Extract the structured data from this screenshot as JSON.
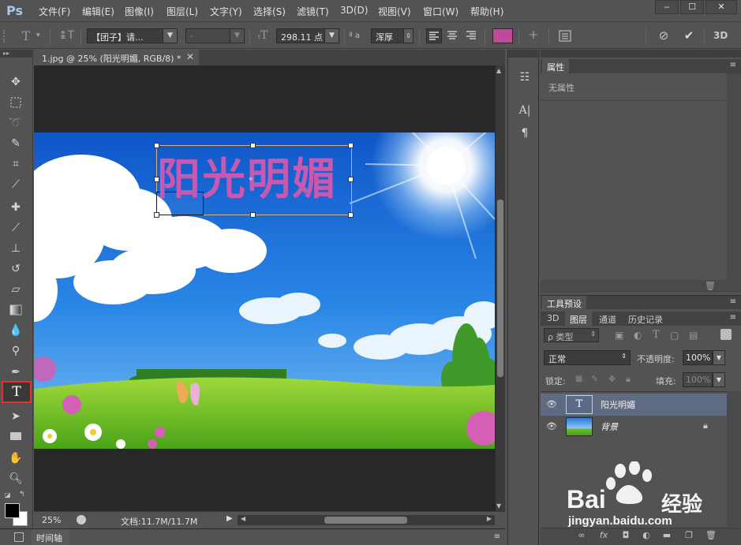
{
  "app": {
    "logo": "Ps",
    "menu": [
      "文件(F)",
      "编辑(E)",
      "图像(I)",
      "图层(L)",
      "文字(Y)",
      "选择(S)",
      "滤镜(T)",
      "3D(D)",
      "视图(V)",
      "窗口(W)",
      "帮助(H)"
    ],
    "window_controls": [
      "‒",
      "☐",
      "✕"
    ]
  },
  "options_bar": {
    "tool_icon": "type-tool-icon",
    "orientation_icon": "text-orientation-icon",
    "font_family": "【团子】请...",
    "font_style": "-",
    "font_size": "298.11 点",
    "aa_label": "ª a",
    "antialias": "浑厚",
    "text_color": "#c0499b",
    "threed_label": "3D"
  },
  "document": {
    "tab_title": "1.jpg @ 25% (阳光明媚, RGB/8) *",
    "tab_close": "✕",
    "canvas_text": "阳光明媚",
    "canvas_text_color": "#c75ab0",
    "zoom": "25%",
    "doc_info": "文档:11.7M/11.7M"
  },
  "timeline": {
    "label": "时间轴"
  },
  "properties_panel": {
    "tab": "属性",
    "empty_text": "无属性"
  },
  "tool_presets_panel": {
    "tab": "工具预设"
  },
  "layers_panel": {
    "tabs": [
      "3D",
      "图层",
      "通道",
      "历史记录"
    ],
    "active_tab_index": 1,
    "filter_kind": "ρ 类型",
    "blend_mode": "正常",
    "opacity_label": "不透明度:",
    "opacity_value": "100%",
    "lock_label": "锁定:",
    "fill_label": "填充:",
    "fill_value": "100%",
    "layers": [
      {
        "name": "阳光明媚",
        "type": "text",
        "selected": true,
        "locked": false
      },
      {
        "name": "背景",
        "type": "image",
        "selected": false,
        "locked": true
      }
    ]
  },
  "watermark": {
    "brand": "Bai",
    "brand2": "经验",
    "url": "jingyan.baidu.com"
  }
}
